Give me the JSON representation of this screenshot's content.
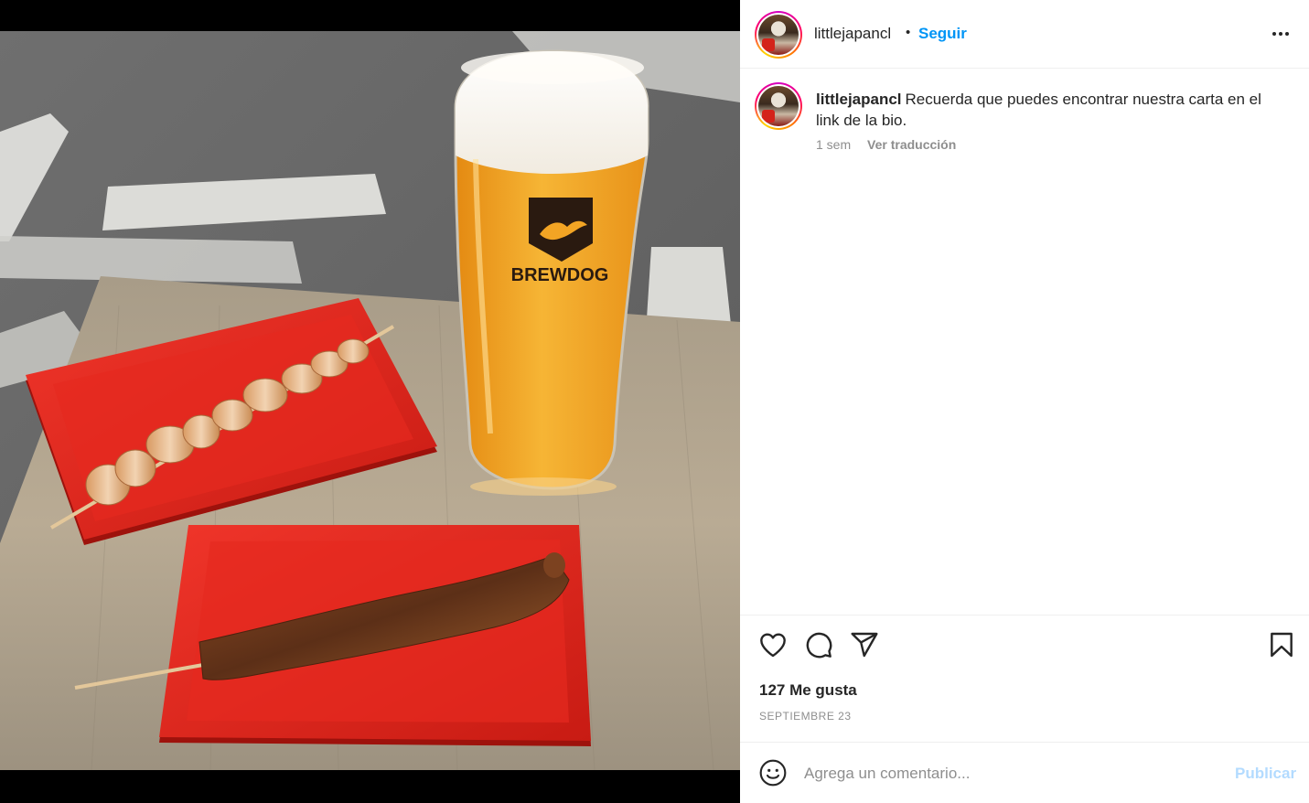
{
  "post": {
    "image_alt": "Brochetas en platos rojos y vaso de cerveza BrewDog",
    "glass_logo_text": "BREWDOG"
  },
  "header": {
    "username": "littlejapancl",
    "separator": "•",
    "follow_label": "Seguir",
    "more_icon": "more-horizontal-icon"
  },
  "caption": {
    "username": "littlejapancl",
    "text": "Recuerda que puedes encontrar nuestra carta en el link de la bio.",
    "time": "1 sem",
    "translate_label": "Ver traducción"
  },
  "actions": {
    "like_icon": "heart-icon",
    "comment_icon": "comment-icon",
    "share_icon": "send-icon",
    "save_icon": "bookmark-icon",
    "likes_text": "127 Me gusta",
    "date_text": "SEPTIEMBRE 23"
  },
  "comment": {
    "emoji_icon": "emoji-icon",
    "placeholder": "Agrega un comentario...",
    "value": "",
    "publish_label": "Publicar"
  },
  "colors": {
    "accent": "#0095f6",
    "publish_disabled": "#b3dbff",
    "text": "#262626",
    "muted": "#8e8e8e",
    "tray_red": "#e3231a",
    "beer": "#f2a424"
  }
}
